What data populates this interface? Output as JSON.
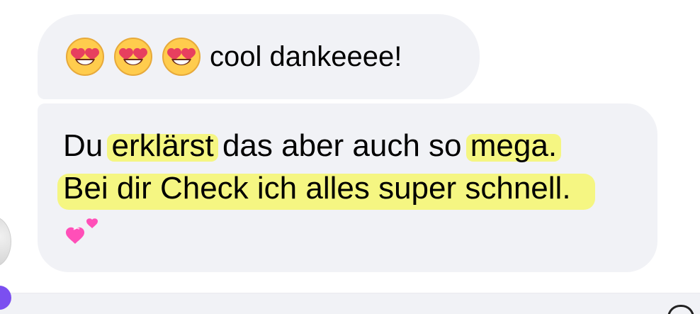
{
  "conversation": {
    "messages": [
      {
        "emojis": [
          "smiling-face-with-heart-eyes",
          "smiling-face-with-heart-eyes",
          "smiling-face-with-heart-eyes"
        ],
        "text": "cool dankeeee!"
      },
      {
        "line1": {
          "before": "Du ",
          "highlight_1": "erklärst",
          "middle": " das aber auch so ",
          "highlight_2": "mega.",
          "after": ""
        },
        "line2": "Bei dir Check ich alles super schnell.",
        "emoji": "two-hearts"
      }
    ]
  },
  "colors": {
    "bubble_bg": "#f1f2f6",
    "highlight": "#f4f57b",
    "text": "#111111",
    "accent": "#7b4ff0"
  }
}
